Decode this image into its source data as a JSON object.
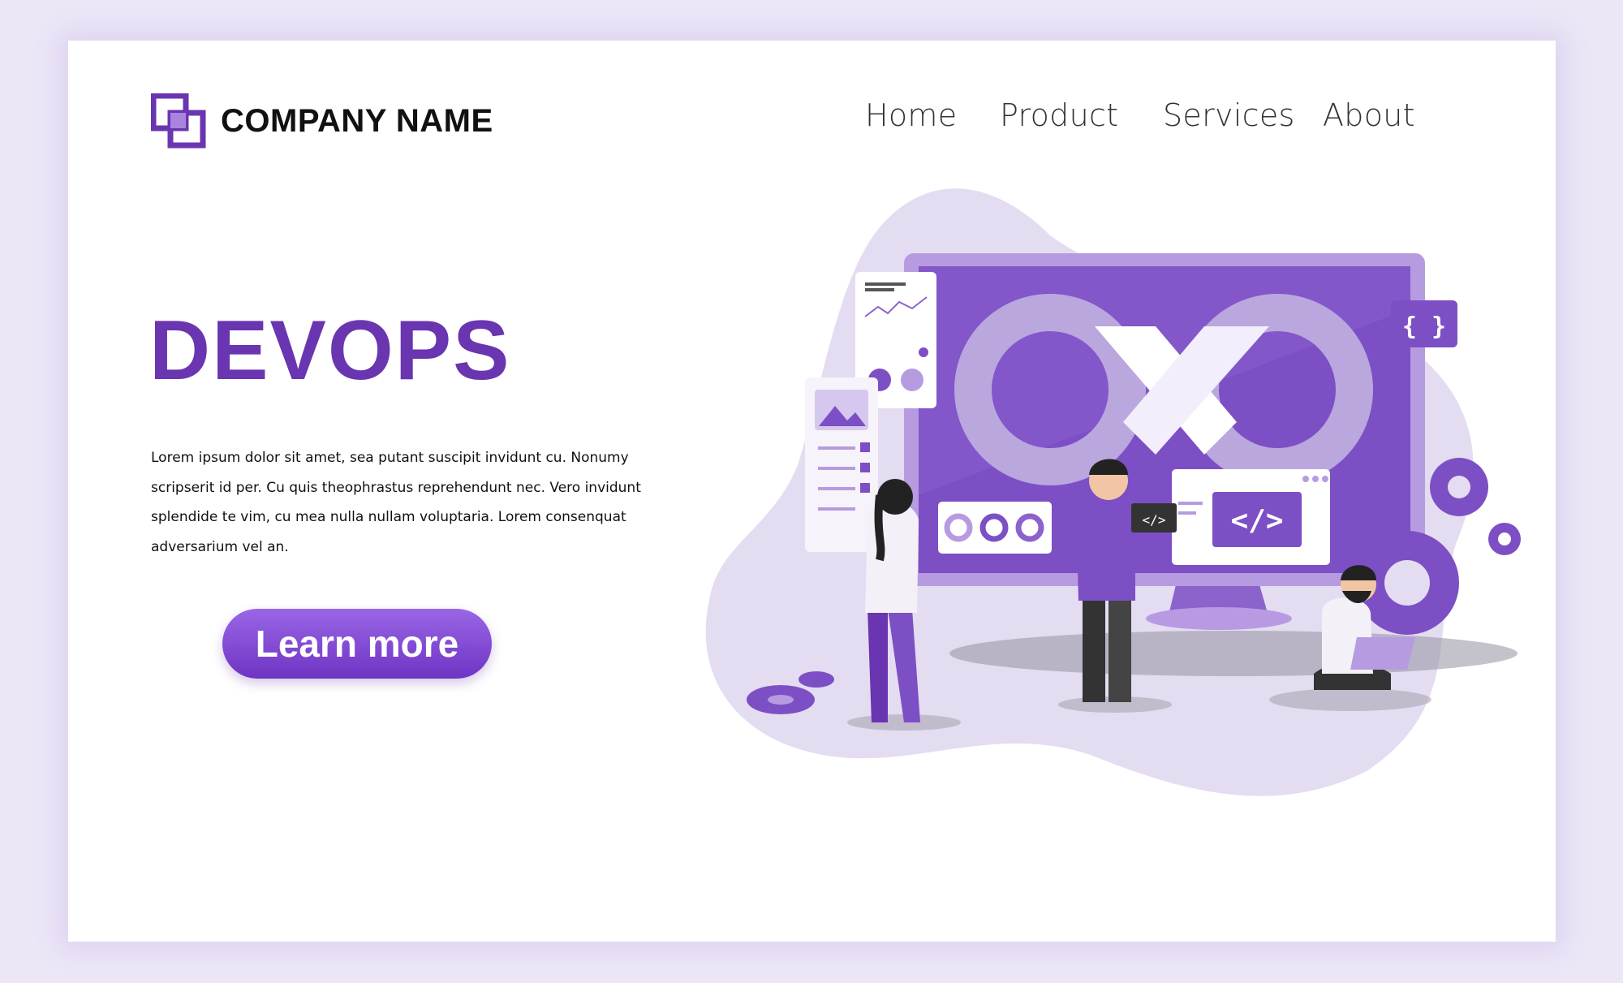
{
  "header": {
    "company_name": "COMPANY NAME",
    "logo_icon": "overlapping-squares-icon"
  },
  "nav": {
    "items": [
      {
        "label": "Home"
      },
      {
        "label": "Product"
      },
      {
        "label": "Services"
      },
      {
        "label": "About"
      }
    ]
  },
  "hero": {
    "title": "DEVOPS",
    "body": "Lorem ipsum dolor sit amet, sea putant suscipit invidunt cu. Nonumy scripserit id per. Cu quis theophrastus reprehendunt nec. Vero invidunt splendide te vim, cu mea nulla nullam voluptaria. Lorem consenquat adversarium vel an.",
    "cta_label": "Learn more"
  },
  "illustration": {
    "code_tag": "</>",
    "braces": "{ }",
    "small_code_tag": "</>"
  },
  "colors": {
    "accent": "#6a35b0",
    "accent_light": "#9a66e6",
    "blob": "#e4dcf1",
    "monitor": "#7d4fc4"
  }
}
